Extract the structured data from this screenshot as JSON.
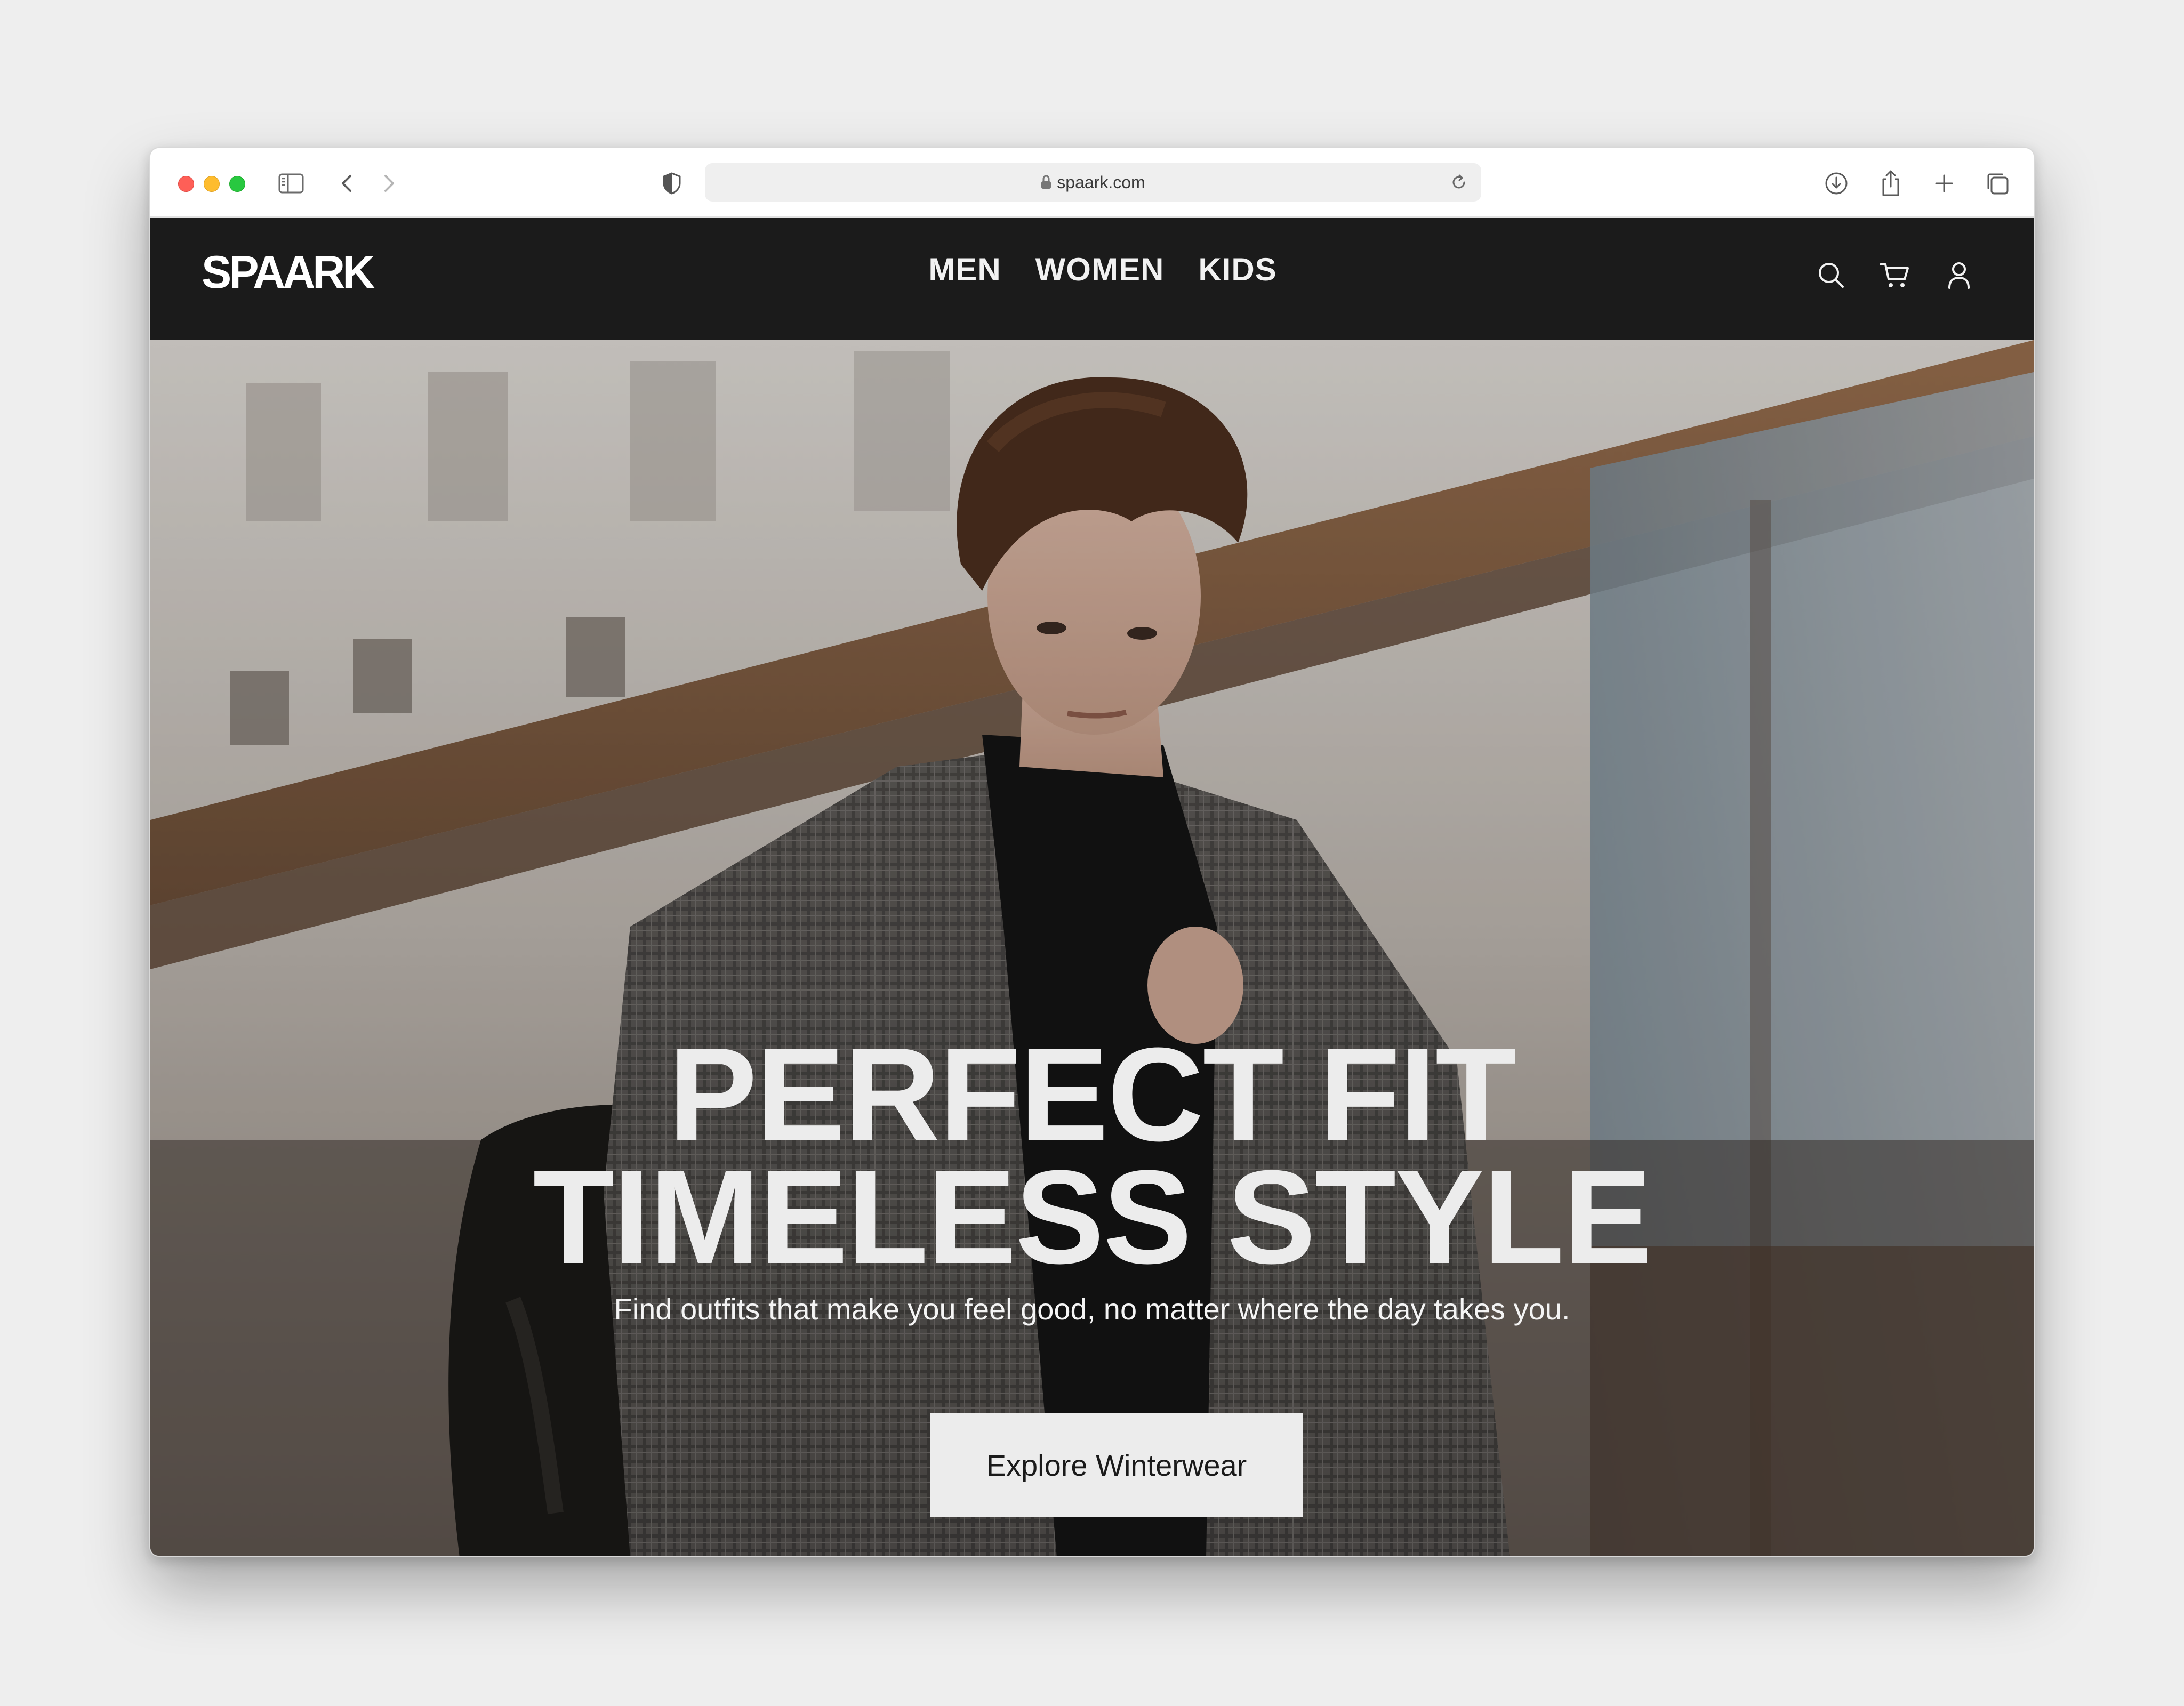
{
  "browser": {
    "url": "spaark.com"
  },
  "site": {
    "logo": "SPAARK",
    "nav": [
      "MEN",
      "WOMEN",
      "KIDS"
    ]
  },
  "hero": {
    "title_line1": "PERFECT FIT",
    "title_line2": "TIMELESS STYLE",
    "subtitle": "Find outfits that make you feel good, no matter where the day takes you.",
    "cta": "Explore Winterwear"
  },
  "colors": {
    "nav_bg": "#1b1b1b",
    "hero_text": "#ececec",
    "cta_bg": "#ececec",
    "page_bg": "#eeeeee"
  },
  "icons": {
    "chrome": [
      "sidebar-icon",
      "back-icon",
      "forward-icon",
      "shield-icon",
      "lock-icon",
      "reload-icon",
      "download-icon",
      "share-icon",
      "new-tab-icon",
      "tabs-overview-icon"
    ],
    "site": [
      "search-icon",
      "cart-icon",
      "account-icon"
    ]
  }
}
